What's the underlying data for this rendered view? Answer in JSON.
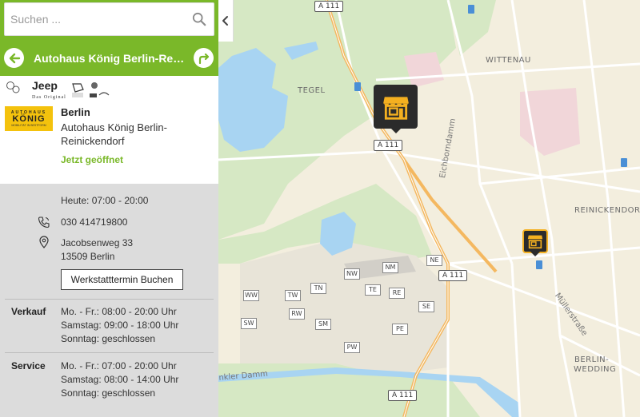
{
  "search": {
    "placeholder": "Suchen ..."
  },
  "header": {
    "title": "Autohaus König Berlin-Reinickendorf"
  },
  "brands": {
    "jeep": "Jeep",
    "jeep_tagline": "Das Original"
  },
  "logo": {
    "small_text": "AUTOHAUS",
    "big_text": "KÖNIG",
    "tiny_text": "MOBILITÄT IN BESTFORM"
  },
  "shop": {
    "city": "Berlin",
    "name": "Autohaus König Berlin-Reinickendorf",
    "status": "Jetzt geöffnet",
    "today": "Heute: 07:00 - 20:00",
    "phone": "030 414719800",
    "street": "Jacobsenweg 33",
    "zip_city": "13509 Berlin",
    "booking_label": "Werkstatttermin Buchen"
  },
  "hours": {
    "sales_label": "Verkauf",
    "sales": [
      "Mo. - Fr.: 08:00 - 20:00 Uhr",
      "Samstag: 09:00 - 18:00 Uhr",
      "Sonntag: geschlossen"
    ],
    "service_label": "Service",
    "service": [
      "Mo. - Fr.: 07:00 - 20:00 Uhr",
      "Samstag: 08:00 - 14:00 Uhr",
      "Sonntag: geschlossen"
    ]
  },
  "map": {
    "districts": {
      "tegel": "TEGEL",
      "wittenau": "WITTENAU",
      "reinickendorf": "REINICKENDORF",
      "wedding_1": "BERLIN-",
      "wedding_2": "WEDDING"
    },
    "roads": {
      "a111_top": "A 111",
      "a111_mid": "A 111",
      "a111_east": "A 111",
      "a111_bottom": "A 111"
    },
    "streets": {
      "eichborndamm": "Eichborndamm",
      "muellerstrasse": "Müllerstraße",
      "damm": "nkler Damm"
    },
    "sectors": {
      "nw": "NW",
      "nm": "NM",
      "ne": "NE",
      "tw": "TW",
      "te": "TE",
      "re": "RE",
      "wwest": "WW",
      "tn": "TN",
      "rw": "RW",
      "sw": "SW",
      "sm": "SM",
      "se": "SE",
      "pe": "PE",
      "pw": "PW"
    },
    "colors": {
      "accent": "#7ab829",
      "water": "#a8d4f2",
      "park": "#d6e8c4",
      "road": "#f4b860",
      "land": "#f3eede"
    }
  },
  "icons": [
    "search-icon",
    "chevron-left-icon",
    "arrow-left-icon",
    "route-icon",
    "phone-icon",
    "location-pin-icon",
    "shop-icon"
  ]
}
